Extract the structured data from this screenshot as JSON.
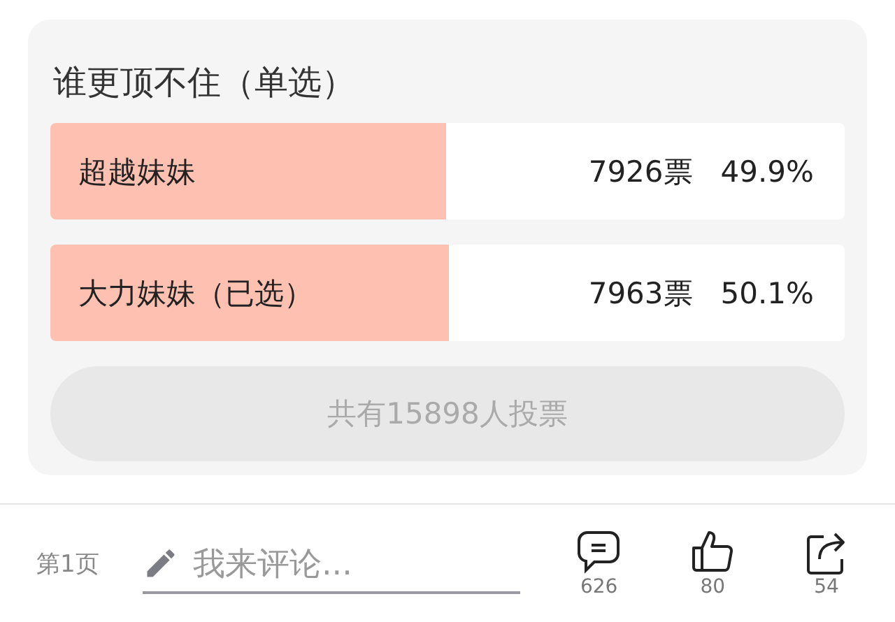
{
  "poll": {
    "title": "谁更顶不住（单选）",
    "options": [
      {
        "label": "超越妹妹",
        "votes": "7926票",
        "percent": "49.9%",
        "level": 0.499
      },
      {
        "label": "大力妹妹（已选）",
        "votes": "7963票",
        "percent": "50.1%",
        "level": 0.501
      }
    ],
    "total": "共有15898人投票"
  },
  "bottom_bar": {
    "page": "第1页",
    "comment_placeholder": "我来评论...",
    "comments": "626",
    "likes": "80",
    "shares": "54"
  }
}
